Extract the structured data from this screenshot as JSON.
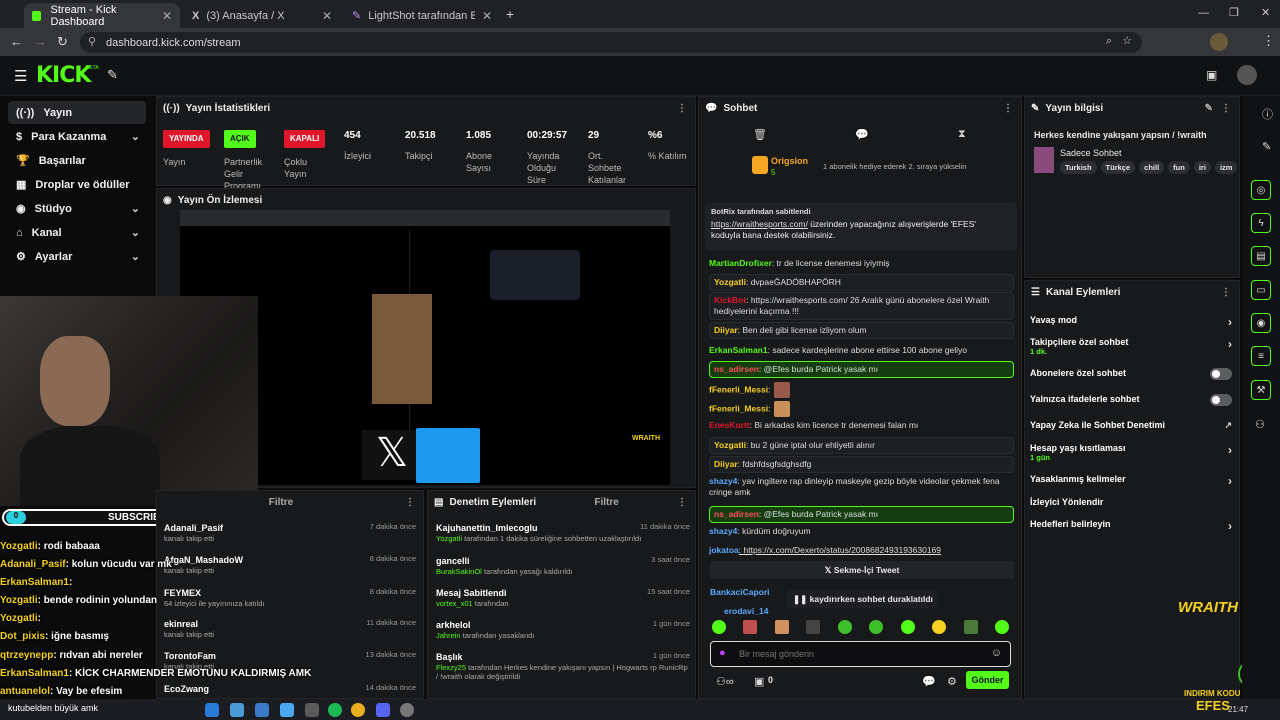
{
  "browser": {
    "tabs": [
      {
        "label": "Stream - Kick Dashboard"
      },
      {
        "label": "(3) Anasayfa / X"
      },
      {
        "label": "LightShot tarafından Ekran Gör"
      }
    ],
    "new_tab": "+",
    "url": "dashboard.kick.com/stream"
  },
  "header": {
    "logo": "KICK",
    "logo_sup": "BETA"
  },
  "sidebar": {
    "items": [
      {
        "label": "Yayın",
        "icon": "broadcast-icon"
      },
      {
        "label": "Para Kazanma",
        "icon": "money-icon"
      },
      {
        "label": "Başarılar",
        "icon": "trophy-icon"
      },
      {
        "label": "Droplar ve ödüller",
        "icon": "gift-icon"
      },
      {
        "label": "Stüdyo",
        "icon": "studio-icon"
      },
      {
        "label": "Kanal",
        "icon": "channel-icon"
      },
      {
        "label": "Ayarlar",
        "icon": "settings-icon"
      }
    ]
  },
  "stats": {
    "title": "Yayın İstatistikleri",
    "items": [
      {
        "value": "YAYINDA",
        "label": "Yayın",
        "color": "#e0162b"
      },
      {
        "value": "AÇIK",
        "label": "Partnerlik Gelir Programı",
        "color": "#53fc18"
      },
      {
        "value": "KAPALI",
        "label": "Çoklu Yayın",
        "color": "#e0162b"
      },
      {
        "value": "454",
        "label": "İzleyici"
      },
      {
        "value": "20.518",
        "label": "Takipçi"
      },
      {
        "value": "1.085",
        "label": "Abone Sayısı"
      },
      {
        "value": "00:29:57",
        "label": "Yayında Olduğu Süre"
      },
      {
        "value": "29",
        "label": "Ort. Sohbete Katılanlar"
      },
      {
        "value": "%6",
        "label": "% Katılım"
      }
    ]
  },
  "preview": {
    "title": "Yayın Ön İzlemesi",
    "overlay_brand": "WRAITH"
  },
  "subscribers": {
    "count_left": "0",
    "label": "SUBSCRIBERS",
    "count_right": "7"
  },
  "overlay_chat": [
    {
      "user": "Yozgatli",
      "text": ": rodi babaaa",
      "color": "#f5d020"
    },
    {
      "user": "Adanali_Pasif",
      "text": ": kolun vücudu var mk",
      "color": "#f5d020"
    },
    {
      "user": "ErkanSalman1",
      "text": ": ",
      "color": "#f5d020"
    },
    {
      "user": "Yozgatli",
      "text": ": bende rodinin yolundan",
      "color": "#f5d020"
    },
    {
      "user": "Yozgatli",
      "text": ": ",
      "color": "#f5d020"
    },
    {
      "user": "Dot_pixis",
      "text": ": iğne basmış",
      "color": "#f5d020"
    },
    {
      "user": "qtrzeynepp",
      "text": ": rıdvan abi nereler",
      "color": "#f5d020"
    },
    {
      "user": "ErkanSalman1",
      "text": ": KİCK CHARMENDER EMOTUNU KALDIRMIŞ AMK",
      "color": "#f5d020"
    },
    {
      "user": "antuanelol",
      "text": ": Vay be efesim",
      "color": "#f5d020"
    },
    {
      "user": "",
      "text": "kutubelden büyük amk",
      "color": "#f5d020"
    }
  ],
  "feed": {
    "title": "Filtre",
    "items": [
      {
        "name": "Adanali_Pasif",
        "desc": "kanalı takip etti",
        "time": "7 dakika önce"
      },
      {
        "name": "AfgaN_MashadoW",
        "desc": "kanalı takip etti",
        "time": "8 dakika önce"
      },
      {
        "name": "FEYMEX",
        "desc": "64 izleyici ile yayınınıza katıldı",
        "time": "8 dakika önce"
      },
      {
        "name": "ekinreal",
        "desc": "kanalı takip etti",
        "time": "11 dakika önce"
      },
      {
        "name": "TorontoFam",
        "desc": "kanalı takip etti",
        "time": "13 dakika önce"
      },
      {
        "name": "EcoZwang",
        "desc": "",
        "time": "14 dakika önce"
      }
    ]
  },
  "moderation": {
    "title": "Denetim Eylemleri",
    "filter": "Filtre",
    "items": [
      {
        "name": "Kajuhanettin_Imlecoglu",
        "who": "Yozgatli",
        "desc": " tarafından 1 dakika süreliğine sohbetten uzaklaştırıldı",
        "time": "11 dakika önce"
      },
      {
        "name": "gancelli",
        "who": "BurakSakinOl",
        "desc": " tarafından yasağı kaldırıldı",
        "time": "3 saat önce"
      },
      {
        "name": "Mesaj Sabitlendi",
        "who": "vortex_x01",
        "desc": " tarafından",
        "time": "15 saat önce"
      },
      {
        "name": "arkhelol",
        "who": "Jahrein",
        "desc": " tarafından yasaklandı",
        "time": "1 gün önce"
      },
      {
        "name": "Başlık",
        "who": "Flexzy25",
        "desc": " tarafından Herkes kendine yakışanı yapsın | Hogwarts rp RunicRp / !wraith olarak değiştirildi",
        "time": "1 gün önce"
      }
    ]
  },
  "chat": {
    "title": "Sohbet",
    "gifter": {
      "name": "Origsion",
      "count": "5",
      "text": "1 abonelik hediye ederek 2. sıraya yükselin"
    },
    "pinned": {
      "by": "BotRix tarafından sabitlendi",
      "link": "https://wraithesports.com/",
      "text": " üzerinden yapacağınız alışverişlerde 'EFES' koduyla bana destek olabilirsiniz."
    },
    "messages": [
      {
        "user": "MartianDrofixer",
        "text": ": tr de license denemesi iyiymiş",
        "color": "#53fc18",
        "style": ""
      },
      {
        "user": "Yozgatli",
        "text": ": dvpaeĞADÖBHAPÖRH",
        "color": "#f5d020",
        "style": "hl2"
      },
      {
        "user": "KickBot",
        "text": ": https://wraithesports.com/ 26 Aralık günü abonelere özel Wraith hediyelerini kaçırma !!!",
        "color": "#e0162b",
        "style": "hl2"
      },
      {
        "user": "Diiyar",
        "text": ": Ben deli gibi license izliyom olum",
        "color": "#f5d020",
        "style": "hl2"
      },
      {
        "user": "ErkanSalman1",
        "text": ": sadece kardeşlerine abone ettirse 100 abone geliyo",
        "color": "#53fc18",
        "style": ""
      },
      {
        "user": "ns_adirsen",
        "text": ": @Efes burda Patrick yasak mı",
        "color": "#e0162b",
        "style": "hl"
      },
      {
        "user": "fFenerli_Messi",
        "text": ":",
        "color": "#f5d020",
        "style": ""
      },
      {
        "user": "fFenerli_Messi",
        "text": ":",
        "color": "#f5d020",
        "style": ""
      },
      {
        "user": "EnesKurtt",
        "text": ": Bi arkadas kim licence tr denemesi falan mı",
        "color": "#e0162b",
        "style": ""
      },
      {
        "user": "Yozgatli",
        "text": ": bu 2 güne iptal olur ehliyetli alınır",
        "color": "#f5d020",
        "style": "hl2"
      },
      {
        "user": "Diiyar",
        "text": ": fdshfdsgfsdghsdfg",
        "color": "#f5d020",
        "style": "hl2"
      },
      {
        "user": "shazy4",
        "text": ": yav ingiltere rap dinleyip maskeyle gezip böyle videolar çekmek fena cringe amk",
        "color": "#5aa9ff",
        "style": ""
      },
      {
        "user": "ns_adirsen",
        "text": ": @Efes burda Patrick yasak mı",
        "color": "#e0162b",
        "style": "hl"
      },
      {
        "user": "shazy4",
        "text": ": kürdüm doğruyum",
        "color": "#5aa9ff",
        "style": ""
      },
      {
        "user": "jokatoa",
        "text": ": https://x.com/Dexerto/status/2008682493193630169",
        "color": "#5aa9ff",
        "style": ""
      }
    ],
    "embed": "Sekme-İçi Tweet",
    "last_user": "BankaciCapori",
    "last_user2": "erodavi_14",
    "paused": "kaydırırken sohbet duraklatıldı",
    "input_placeholder": "Bir mesaj gönderin",
    "points": "0",
    "send": "Gönder"
  },
  "stream_info": {
    "title": "Yayın bilgisi",
    "stream_title": "Herkes kendine yakışanı yapsın / !wraith",
    "category": "Sadece Sohbet",
    "tags": [
      "Turkish",
      "Türkçe",
      "chill",
      "fun",
      "iri",
      "izm"
    ]
  },
  "channel_actions": {
    "title": "Kanal Eylemleri",
    "items": [
      {
        "label": "Yavaş mod",
        "sub": "",
        "kind": "chev"
      },
      {
        "label": "Takipçilere özel sohbet",
        "sub": "1 dk.",
        "kind": "chev"
      },
      {
        "label": "Abonelere özel sohbet",
        "sub": "",
        "kind": "toggle"
      },
      {
        "label": "Yalnızca ifadelerle sohbet",
        "sub": "",
        "kind": "toggle"
      },
      {
        "label": "Yapay Zeka ile Sohbet Denetimi",
        "sub": "",
        "kind": "ext"
      },
      {
        "label": "Hesap yaşı kısıtlaması",
        "sub": "1 gün",
        "kind": "chev"
      },
      {
        "label": "Yasaklanmış kelimeler",
        "sub": "",
        "kind": "chev"
      },
      {
        "label": "İzleyici Yönlendir",
        "sub": "",
        "kind": "none"
      },
      {
        "label": "Hedefleri belirleyin",
        "sub": "",
        "kind": "chev"
      }
    ]
  },
  "brand_overlay": {
    "wraith": "WRAITH",
    "discount": "INDIRIM KODU",
    "code": "EFES"
  },
  "taskbar": {
    "time": "21:47"
  },
  "colors": {
    "accent": "#53fc18",
    "live": "#e0162b",
    "panel": "#18191b"
  }
}
